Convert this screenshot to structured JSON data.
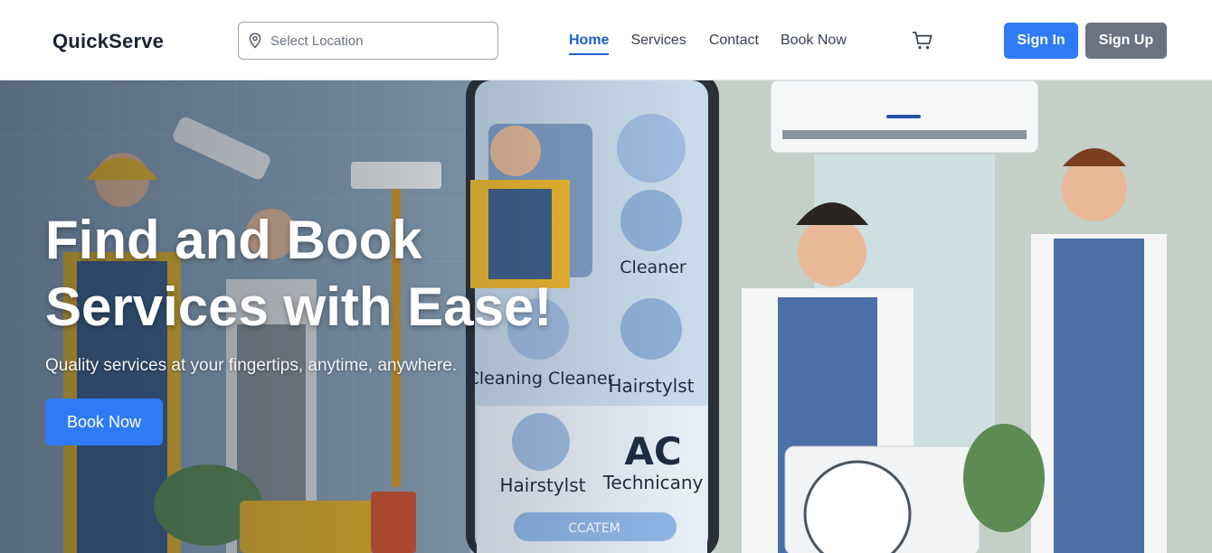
{
  "header": {
    "brand": "QuickServe",
    "location_placeholder": "Select Location",
    "nav": [
      "Home",
      "Services",
      "Contact",
      "Book Now"
    ],
    "active_nav": "Home",
    "sign_in": "Sign In",
    "sign_up": "Sign Up"
  },
  "hero": {
    "title": "Find and Book Services with Ease!",
    "subtitle": "Quality services at your fingertips, anytime, anywhere.",
    "cta": "Book Now",
    "illustration_labels": [
      "Cleaner",
      "Cleaning Cleaner",
      "Hairstylst",
      "Hairstylst",
      "AC",
      "Technicany",
      "CCATEM"
    ]
  },
  "colors": {
    "primary": "#2f7bf5",
    "secondary": "#6b7280",
    "active_link": "#1d5fd1",
    "brand_text": "#1a2233"
  },
  "icons": [
    "location-pin-icon",
    "cart-icon"
  ]
}
